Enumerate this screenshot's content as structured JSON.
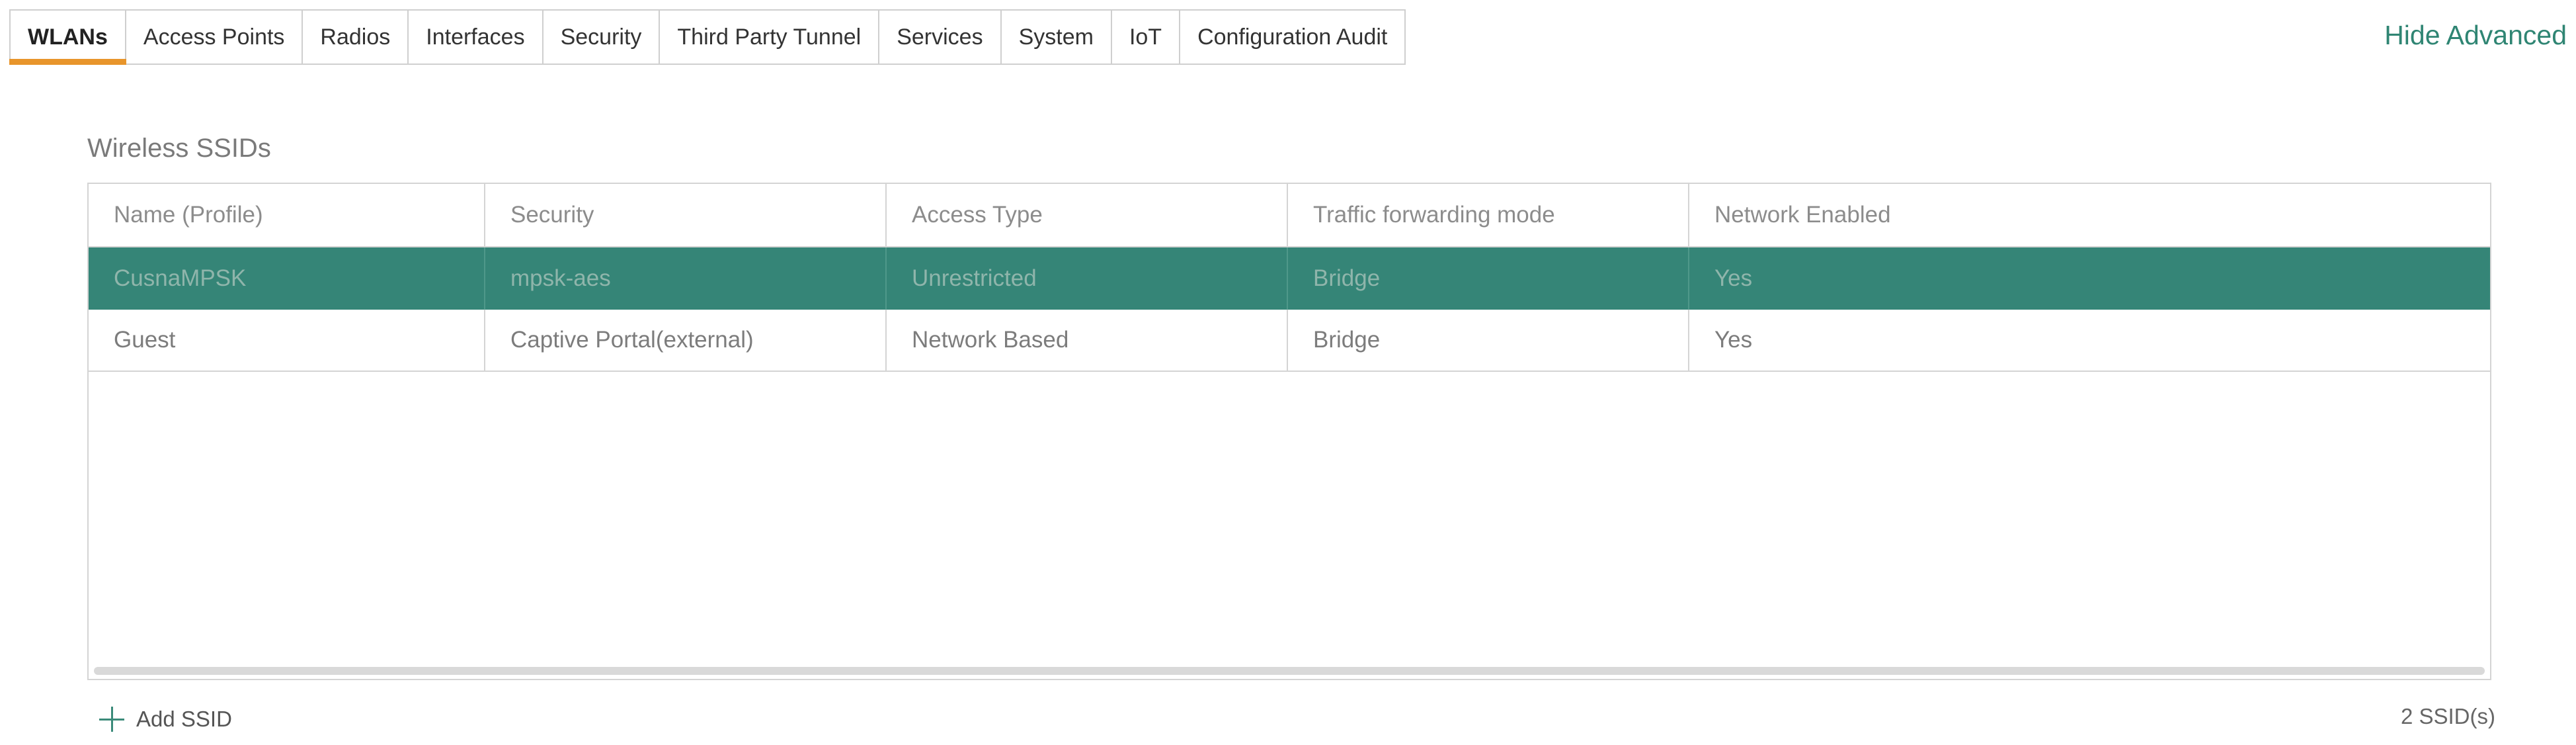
{
  "tabs": [
    {
      "label": "WLANs",
      "active": true
    },
    {
      "label": "Access Points"
    },
    {
      "label": "Radios"
    },
    {
      "label": "Interfaces"
    },
    {
      "label": "Security"
    },
    {
      "label": "Third Party Tunnel"
    },
    {
      "label": "Services"
    },
    {
      "label": "System"
    },
    {
      "label": "IoT"
    },
    {
      "label": "Configuration Audit"
    }
  ],
  "header_link": {
    "hide_advanced": "Hide Advanced",
    "color": "#2f8573"
  },
  "section": {
    "title": "Wireless SSIDs"
  },
  "table": {
    "columns": [
      "Name (Profile)",
      "Security",
      "Access Type",
      "Traffic forwarding mode",
      "Network Enabled"
    ],
    "rows": [
      {
        "selected": true,
        "cells": [
          "CusnaMPSK",
          "mpsk-aes",
          "Unrestricted",
          "Bridge",
          "Yes"
        ]
      },
      {
        "selected": false,
        "cells": [
          "Guest",
          "Captive Portal(external)",
          "Network Based",
          "Bridge",
          "Yes"
        ]
      }
    ],
    "selected_row_color": "#358577"
  },
  "footer": {
    "add_label": "Add SSID",
    "add_icon": "plus-icon",
    "count_text": "2 SSID(s)"
  },
  "colors": {
    "active_tab_underline": "#e8952b",
    "accent": "#2f8573"
  }
}
